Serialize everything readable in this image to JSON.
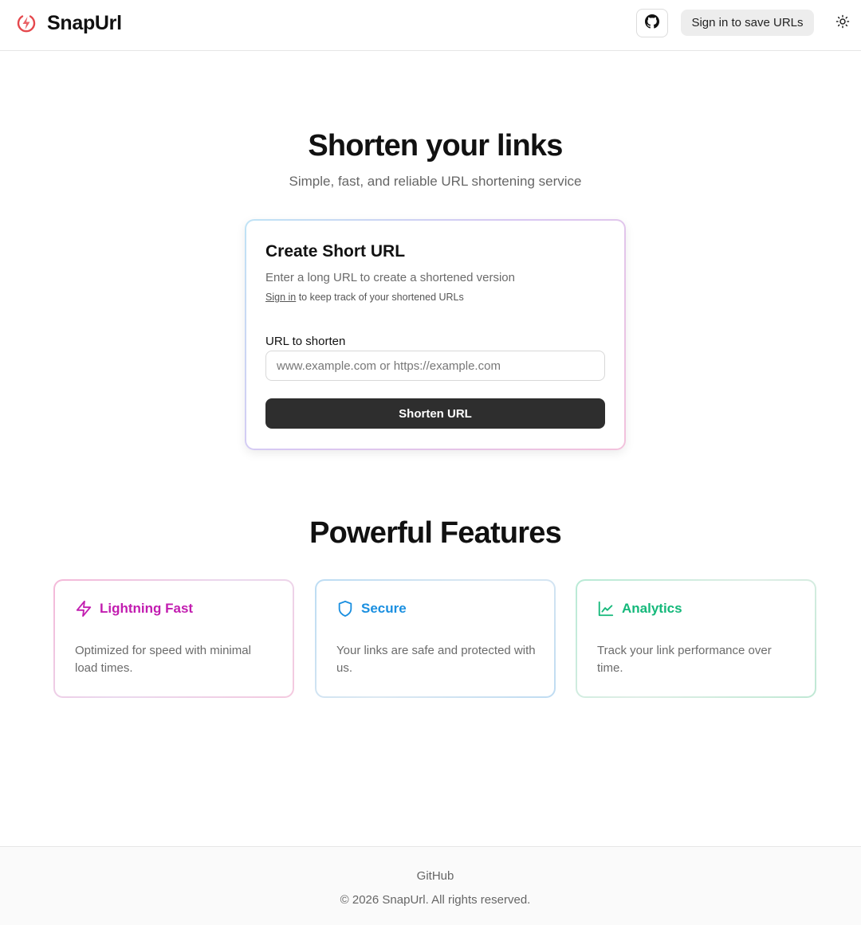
{
  "header": {
    "brand_name": "SnapUrl",
    "brand_icon": "lightning-bolt-circle-icon",
    "github_icon": "github-icon",
    "signin_label": "Sign in to save URLs",
    "theme_icon": "sun-icon"
  },
  "hero": {
    "title": "Shorten your links",
    "subtitle": "Simple, fast, and reliable URL shortening service"
  },
  "shorten_card": {
    "title": "Create Short URL",
    "description": "Enter a long URL to create a shortened version",
    "signin_link": "Sign in",
    "signin_note": " to keep track of your shortened URLs",
    "field_label": "URL to shorten",
    "input_value": "",
    "input_placeholder": "www.example.com or https://example.com",
    "button_label": "Shorten URL"
  },
  "features": {
    "title": "Powerful Features",
    "items": [
      {
        "name": "Lightning Fast",
        "description": "Optimized for speed with minimal load times.",
        "icon": "zap-icon",
        "color": "#c21db0"
      },
      {
        "name": "Secure",
        "description": "Your links are safe and protected with us.",
        "icon": "shield-icon",
        "color": "#1a8fe0"
      },
      {
        "name": "Analytics",
        "description": "Track your link performance over time.",
        "icon": "line-chart-icon",
        "color": "#14b87a"
      }
    ]
  },
  "footer": {
    "link": "GitHub",
    "copyright": "© 2026 SnapUrl. All rights reserved."
  },
  "colors": {
    "brand_red": "#e5484d",
    "primary_button": "#2e2e2e"
  }
}
